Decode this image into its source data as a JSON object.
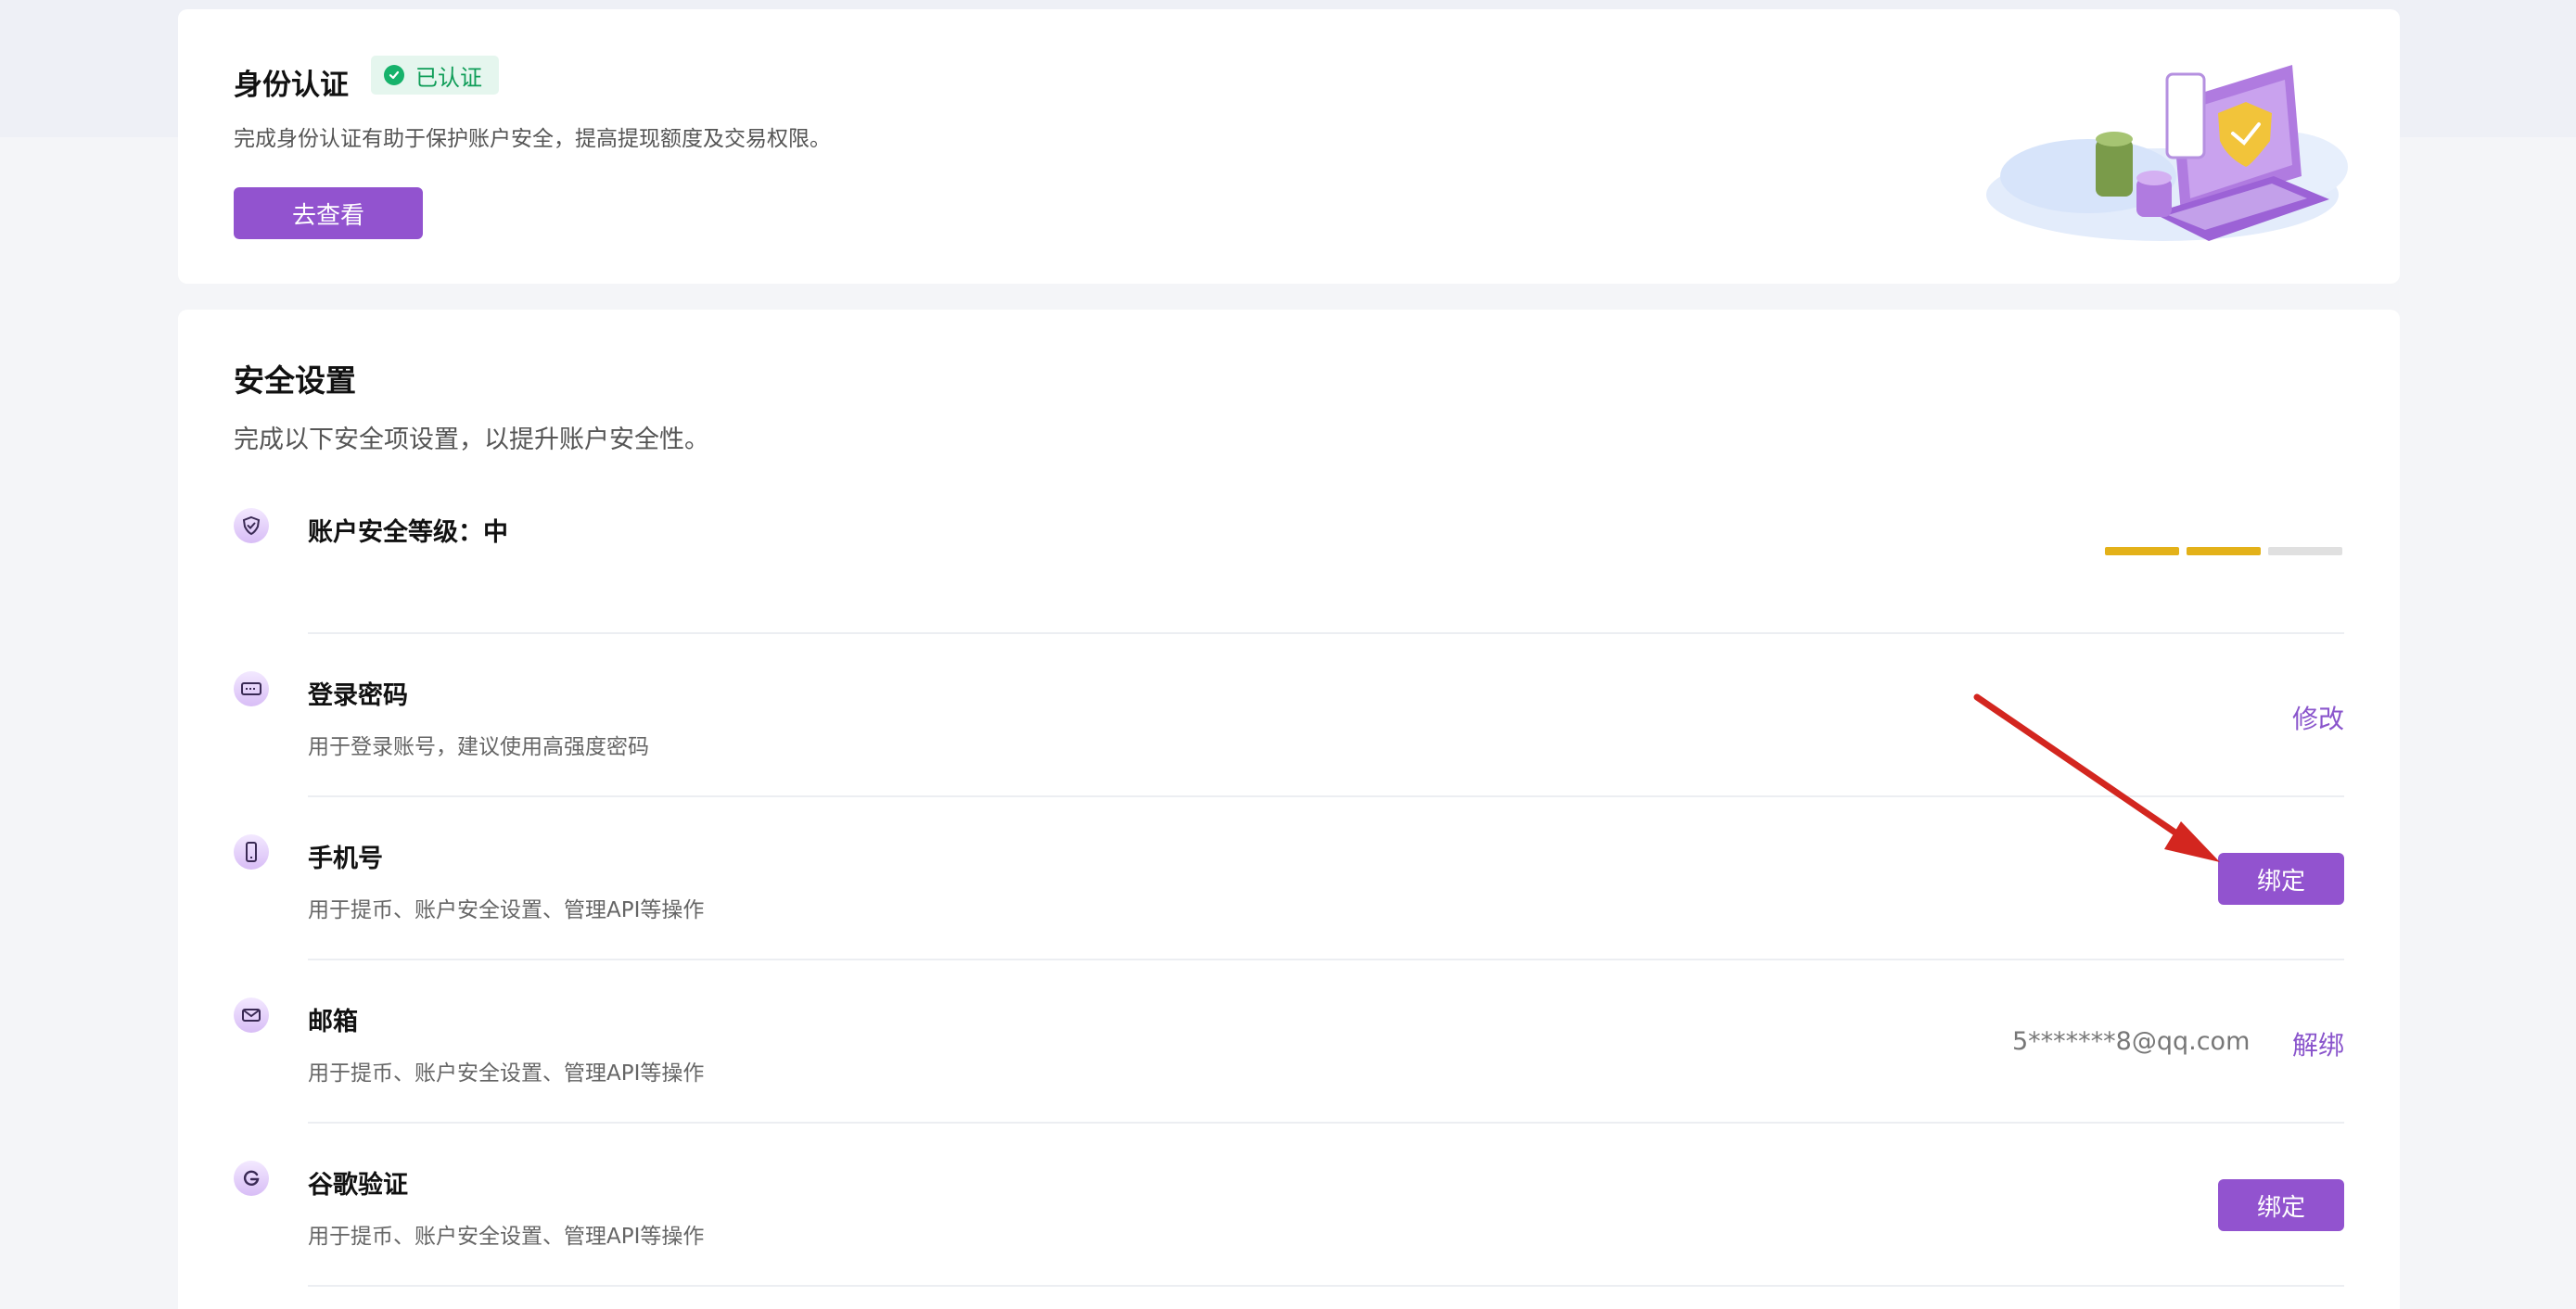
{
  "identity": {
    "title": "身份认证",
    "badge": "已认证",
    "description": "完成身份认证有助于保护账户安全，提高提现额度及交易权限。",
    "view_button": "去查看"
  },
  "security": {
    "title": "安全设置",
    "description": "完成以下安全项设置，以提升账户安全性。",
    "level": {
      "label": "账户安全等级：",
      "value": "中",
      "filled_segments": 2,
      "total_segments": 3,
      "filled_color": "#e3b119",
      "empty_color": "#e0e0e0"
    },
    "items": [
      {
        "label": "登录密码",
        "description": "用于登录账号，建议使用高强度密码",
        "icon": "keyboard-icon",
        "action": "修改",
        "action_type": "link"
      },
      {
        "label": "手机号",
        "description": "用于提币、账户安全设置、管理API等操作",
        "icon": "phone-icon",
        "action": "绑定",
        "action_type": "button"
      },
      {
        "label": "邮箱",
        "description": "用于提币、账户安全设置、管理API等操作",
        "icon": "mail-icon",
        "value": "5*******8@qq.com",
        "action": "解绑",
        "action_type": "link"
      },
      {
        "label": "谷歌验证",
        "description": "用于提币、账户安全设置、管理API等操作",
        "icon": "google-icon",
        "action": "绑定",
        "action_type": "button"
      }
    ]
  },
  "colors": {
    "accent": "#9253cf",
    "link": "#8a55cc",
    "verified": "#16b26b",
    "annotation_arrow": "#d3261f"
  }
}
